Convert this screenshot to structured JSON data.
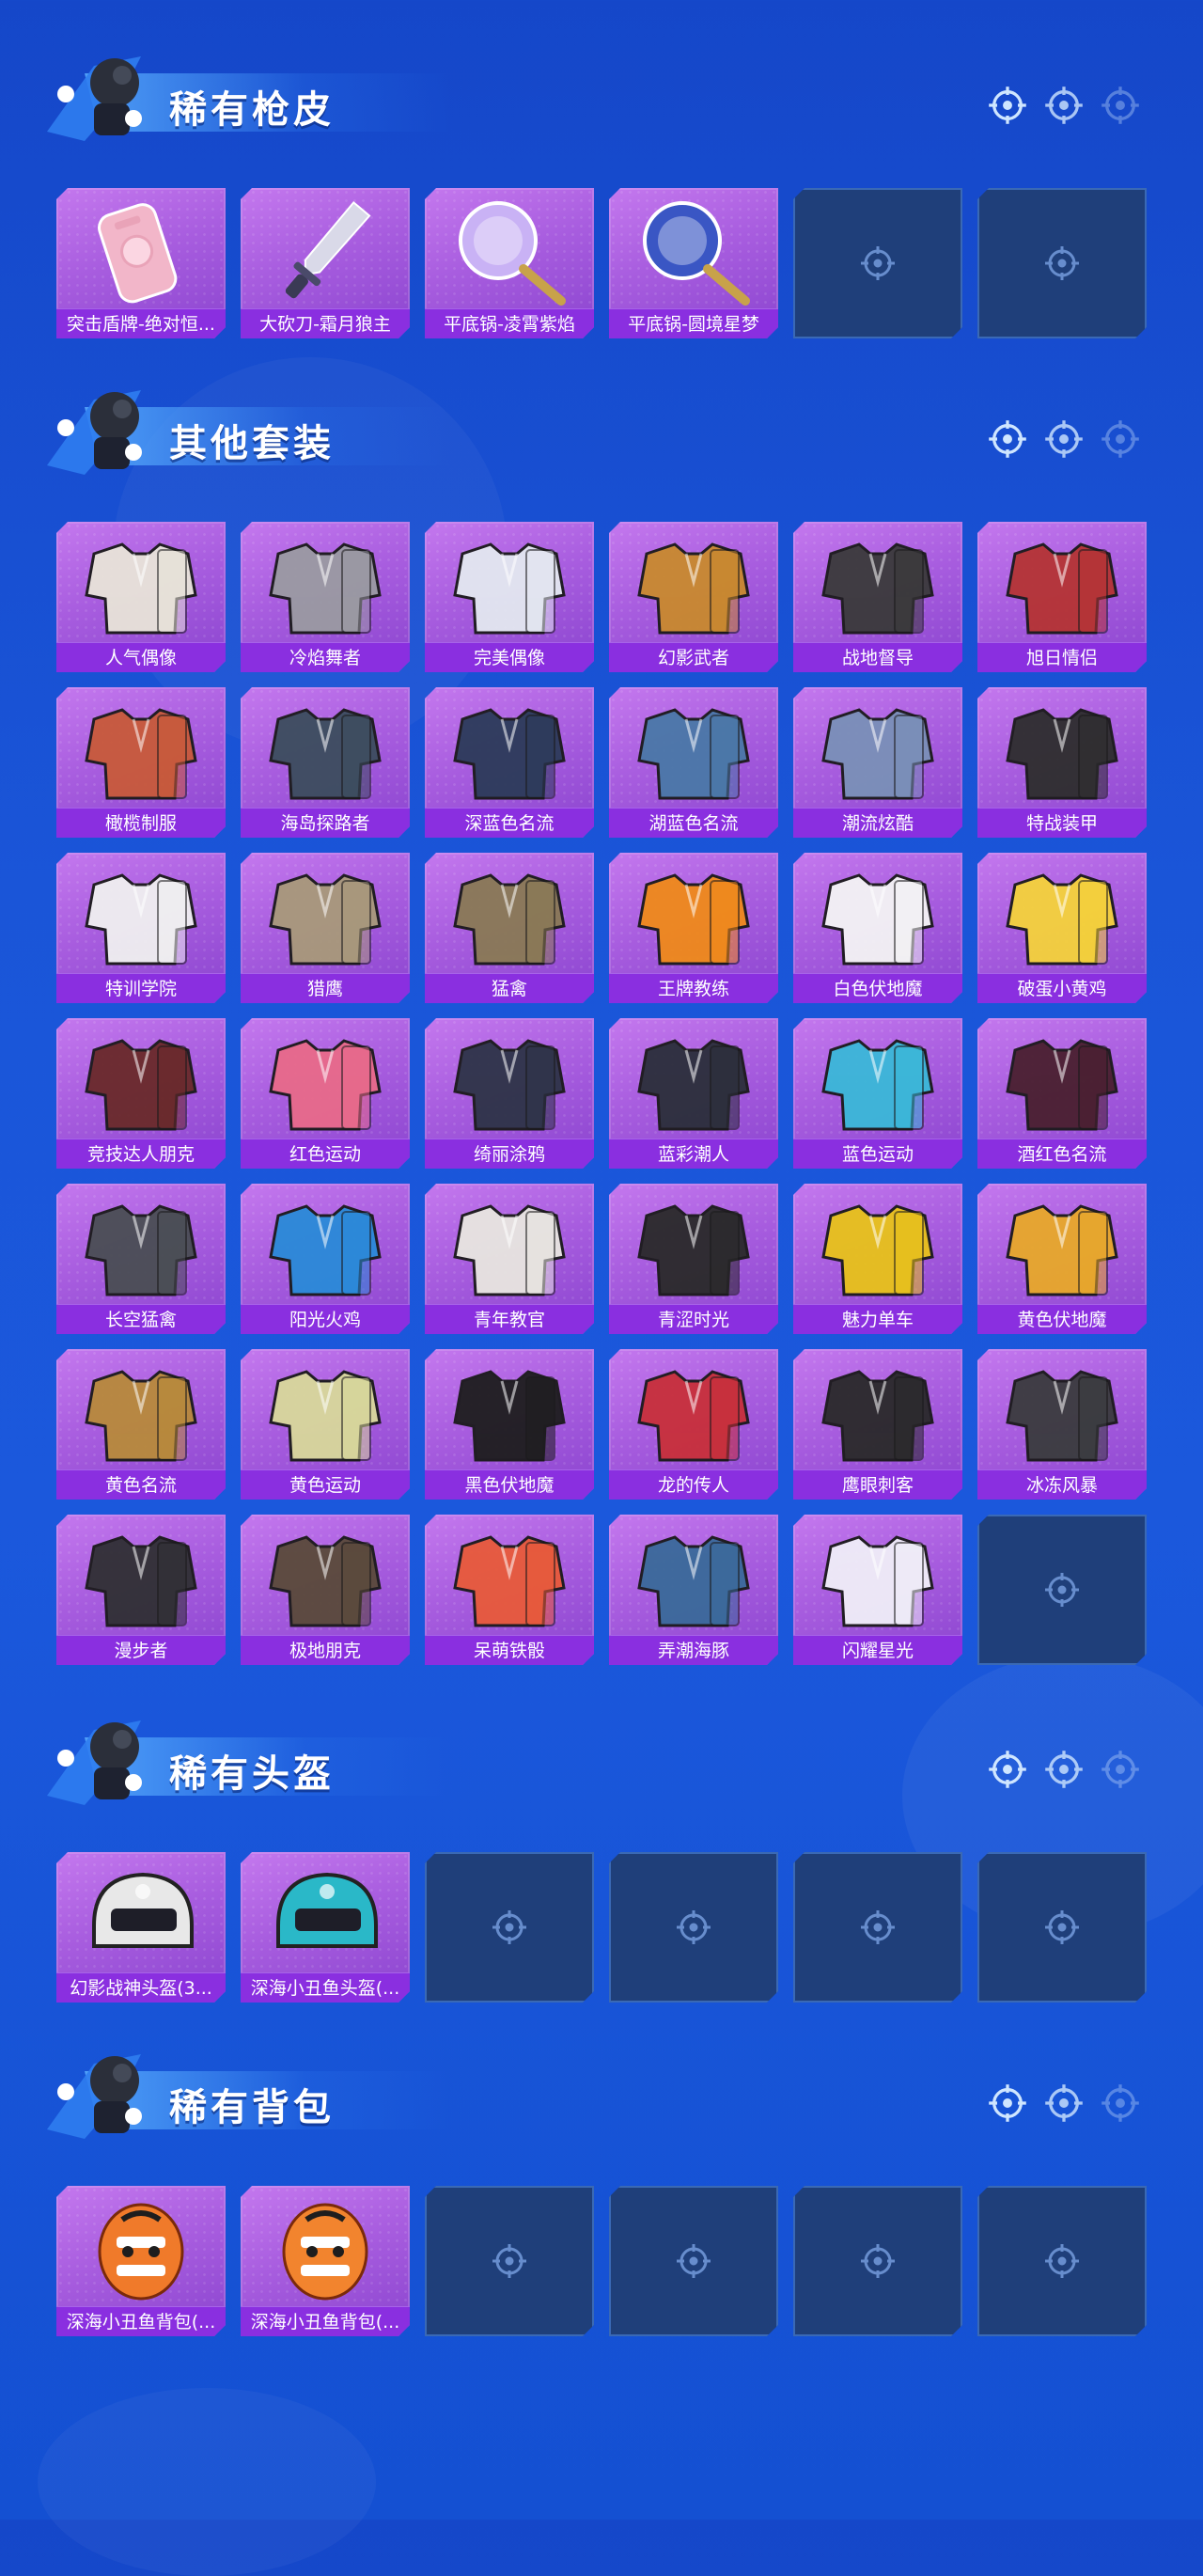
{
  "sections": [
    {
      "title": "稀有枪皮",
      "items": [
        {
          "label": "突击盾牌-绝对恒...",
          "icon": "shield-icon",
          "color": "#f2b6c9"
        },
        {
          "label": "大砍刀-霜月狼主",
          "icon": "machete-icon",
          "color": "#d9d9e8"
        },
        {
          "label": "平底锅-凌霄紫焰",
          "icon": "pan-icon",
          "color": "#c9b2f5"
        },
        {
          "label": "平底锅-圆境星梦",
          "icon": "pan-icon",
          "color": "#3a56c4"
        }
      ],
      "empty_slots": 2
    },
    {
      "title": "其他套装",
      "items": [
        {
          "label": "人气偶像",
          "icon": "outfit-icon",
          "color": "#e8e4d8"
        },
        {
          "label": "冷焰舞者",
          "icon": "outfit-icon",
          "color": "#9a9aa2"
        },
        {
          "label": "完美偶像",
          "icon": "outfit-icon",
          "color": "#e3e8f0"
        },
        {
          "label": "幻影武者",
          "icon": "outfit-icon",
          "color": "#c9892e"
        },
        {
          "label": "战地督导",
          "icon": "outfit-icon",
          "color": "#3a3a3a"
        },
        {
          "label": "旭日情侣",
          "icon": "outfit-icon",
          "color": "#b53434"
        },
        {
          "label": "橄榄制服",
          "icon": "outfit-icon",
          "color": "#c85a3a"
        },
        {
          "label": "海岛探路者",
          "icon": "outfit-icon",
          "color": "#3c4d5e"
        },
        {
          "label": "深蓝色名流",
          "icon": "outfit-icon",
          "color": "#2c3b5a"
        },
        {
          "label": "湖蓝色名流",
          "icon": "outfit-icon",
          "color": "#4a78a8"
        },
        {
          "label": "潮流炫酷",
          "icon": "outfit-icon",
          "color": "#7a90b8"
        },
        {
          "label": "特战装甲",
          "icon": "outfit-icon",
          "color": "#2e2e2e"
        },
        {
          "label": "特训学院",
          "icon": "outfit-icon",
          "color": "#f0f0f0"
        },
        {
          "label": "猎鹰",
          "icon": "outfit-icon",
          "color": "#a8997a"
        },
        {
          "label": "猛禽",
          "icon": "outfit-icon",
          "color": "#8a7a55"
        },
        {
          "label": "王牌教练",
          "icon": "outfit-icon",
          "color": "#f08a1a"
        },
        {
          "label": "白色伏地魔",
          "icon": "outfit-icon",
          "color": "#f4f4f4"
        },
        {
          "label": "破蛋小黄鸡",
          "icon": "outfit-icon",
          "color": "#f5d23a"
        },
        {
          "label": "竞技达人朋克",
          "icon": "outfit-icon",
          "color": "#6a2a2a"
        },
        {
          "label": "红色运动",
          "icon": "outfit-icon",
          "color": "#e86a8a"
        },
        {
          "label": "绮丽涂鸦",
          "icon": "outfit-icon",
          "color": "#2e3448"
        },
        {
          "label": "蓝彩潮人",
          "icon": "outfit-icon",
          "color": "#2b2f3a"
        },
        {
          "label": "蓝色运动",
          "icon": "outfit-icon",
          "color": "#3ab8d8"
        },
        {
          "label": "酒红色名流",
          "icon": "outfit-icon",
          "color": "#4a2030"
        },
        {
          "label": "长空猛禽",
          "icon": "outfit-icon",
          "color": "#4a4e54"
        },
        {
          "label": "阳光火鸡",
          "icon": "outfit-icon",
          "color": "#2a8ad8"
        },
        {
          "label": "青年教官",
          "icon": "outfit-icon",
          "color": "#e8e6e0"
        },
        {
          "label": "青涩时光",
          "icon": "outfit-icon",
          "color": "#2a2a2a"
        },
        {
          "label": "魅力单车",
          "icon": "outfit-icon",
          "color": "#e8c21a"
        },
        {
          "label": "黄色伏地魔",
          "icon": "outfit-icon",
          "color": "#e8a82a"
        },
        {
          "label": "黄色名流",
          "icon": "outfit-icon",
          "color": "#b88a3a"
        },
        {
          "label": "黄色运动",
          "icon": "outfit-icon",
          "color": "#d8d89a"
        },
        {
          "label": "黑色伏地魔",
          "icon": "outfit-icon",
          "color": "#1e1e1e"
        },
        {
          "label": "龙的传人",
          "icon": "outfit-icon",
          "color": "#c8303a"
        },
        {
          "label": "鹰眼刺客",
          "icon": "outfit-icon",
          "color": "#2a2a2a"
        },
        {
          "label": "冰冻风暴",
          "icon": "outfit-icon",
          "color": "#3a3c3e"
        },
        {
          "label": "漫步者",
          "icon": "outfit-icon",
          "color": "#303034"
        },
        {
          "label": "极地朋克",
          "icon": "outfit-icon",
          "color": "#5a4a3a"
        },
        {
          "label": "呆萌铁骰",
          "icon": "outfit-icon",
          "color": "#e85a3a"
        },
        {
          "label": "弄潮海豚",
          "icon": "outfit-icon",
          "color": "#3a6a9a"
        },
        {
          "label": "闪耀星光",
          "icon": "outfit-icon",
          "color": "#f0eef8"
        }
      ],
      "empty_slots": 1
    },
    {
      "title": "稀有头盔",
      "items": [
        {
          "label": "幻影战神头盔(3...",
          "icon": "helmet-icon",
          "color": "#e8e8e8"
        },
        {
          "label": "深海小丑鱼头盔(...",
          "icon": "helmet-icon",
          "color": "#2ab8c8"
        }
      ],
      "empty_slots": 4
    },
    {
      "title": "稀有背包",
      "items": [
        {
          "label": "深海小丑鱼背包(...",
          "icon": "backpack-icon",
          "color": "#f07a2a"
        },
        {
          "label": "深海小丑鱼背包(...",
          "icon": "backpack-icon",
          "color": "#f2842e"
        }
      ],
      "empty_slots": 4
    }
  ]
}
